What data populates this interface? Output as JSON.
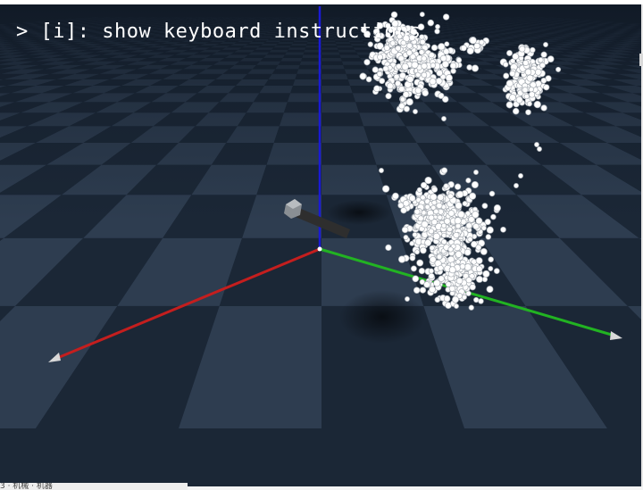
{
  "viewer": {
    "overlay_text": "> [i]: show keyboard instructions",
    "status_caption": "3 · 机械 · 机器"
  },
  "colors": {
    "floor_dark": "#1b2736",
    "floor_light": "#2e3d50",
    "axis_x": "#c41e1e",
    "axis_y": "#22b322",
    "axis_z": "#1a1ad6",
    "points": "#ffffff",
    "gripper": "#3a3a3a"
  },
  "scene": {
    "axes": [
      "x-axis",
      "y-axis",
      "z-axis"
    ],
    "objects": [
      "point-cloud-top-left",
      "point-cloud-top-right",
      "point-cloud-center",
      "gripper-marker"
    ]
  }
}
